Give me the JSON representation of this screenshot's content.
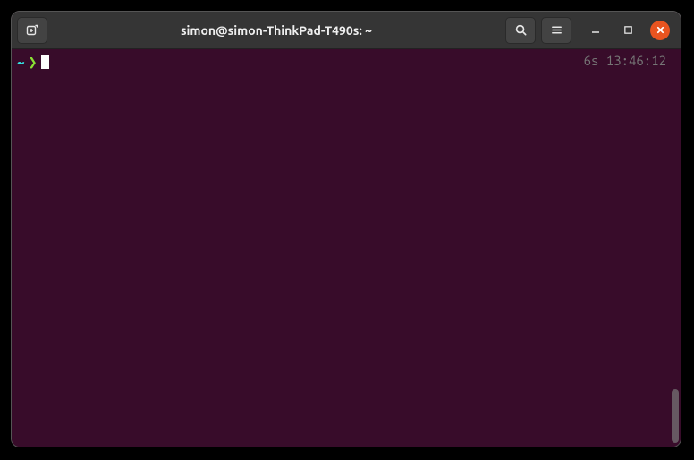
{
  "window": {
    "title": "simon@simon-ThinkPad-T490s: ~"
  },
  "prompt": {
    "home_indicator": "~",
    "arrow": "❯",
    "input": ""
  },
  "rprompt": {
    "duration": "6s",
    "clock": "13:46:12"
  },
  "colors": {
    "bg": "#380c2a",
    "titlebar": "#353535",
    "close": "#e95420",
    "prompt_home": "#34e2e2",
    "prompt_arrow": "#8ae234",
    "muted": "#767676"
  },
  "icons": {
    "new_tab": "new-tab-icon",
    "search": "search-icon",
    "menu": "hamburger-menu-icon",
    "minimize": "minimize-icon",
    "maximize": "maximize-icon",
    "close": "close-icon"
  }
}
